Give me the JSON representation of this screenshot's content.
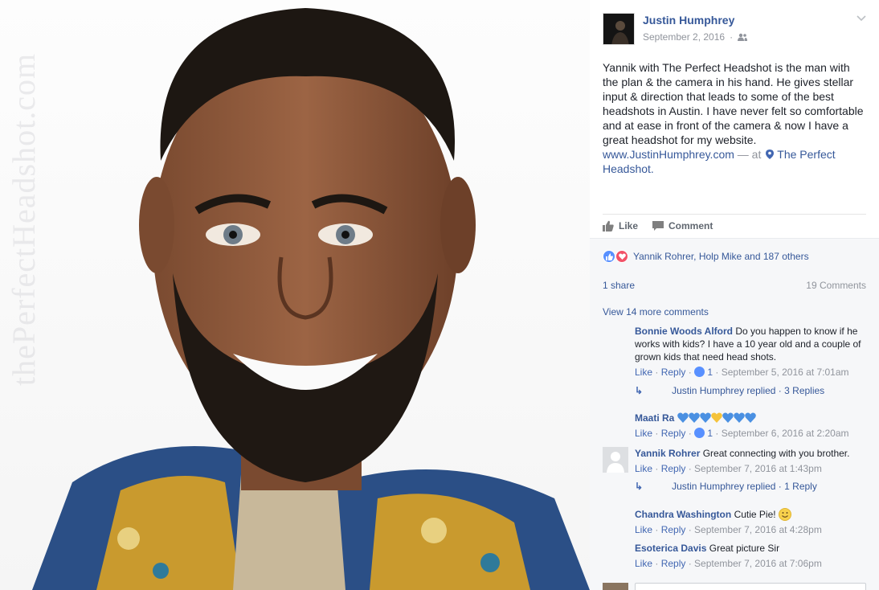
{
  "photo": {
    "watermark": "thePerfectHeadshot.com",
    "background_color": "#f8f8f8"
  },
  "post": {
    "author": "Justin Humphrey",
    "date": "September 2, 2016",
    "audience_icon": "friends-icon",
    "text": "Yannik with The Perfect Headshot is the man with the plan & the camera in his hand. He gives stellar input & direction that leads to some of the best headshots in Austin. I have never felt so comfortable and at ease in front of the camera & now I have a great headshot for my website.",
    "website": "www.JustinHumphrey.com",
    "at_separator": " — at ",
    "location": "The Perfect Headshot.",
    "like_label": "Like",
    "comment_label": "Comment"
  },
  "engagement": {
    "reactions_text": "Yannik Rohrer, Holp Mike and 187 others",
    "shares": "1 share",
    "comments_count": "19 Comments",
    "view_more": "View 14 more comments"
  },
  "comments": [
    {
      "name": "Bonnie Woods Alford",
      "text": "Do you happen to know if he works with kids? I have a 10 year old and a couple of grown kids that need head shots.",
      "like": "Like",
      "reply": "Reply",
      "likes": "1",
      "time": "September 5, 2016 at 7:01am",
      "replies": {
        "who": "Justin Humphrey replied",
        "count": "3 Replies"
      }
    },
    {
      "name": "Maati Ra",
      "text": "",
      "like": "Like",
      "reply": "Reply",
      "likes": "1",
      "time": "September 6, 2016 at 2:20am"
    },
    {
      "name": "Yannik Rohrer",
      "text": "Great connecting with you brother.",
      "like": "Like",
      "reply": "Reply",
      "time": "September 7, 2016 at 1:43pm",
      "replies": {
        "who": "Justin Humphrey replied",
        "count": "1 Reply"
      }
    },
    {
      "name": "Chandra Washington",
      "text": "Cutie Pie!",
      "like": "Like",
      "reply": "Reply",
      "time": "September 7, 2016 at 4:28pm"
    },
    {
      "name": "Esoterica Davis",
      "text": "Great picture Sir",
      "like": "Like",
      "reply": "Reply",
      "time": "September 7, 2016 at 7:06pm"
    }
  ],
  "colors": {
    "link": "#365899",
    "muted": "#90949c",
    "like_blue": "#5890ff",
    "love_red": "#f25268",
    "heart_blue": "#4a90e2",
    "heart_yellow": "#f5c33b"
  },
  "separators": {
    "dot": " · "
  }
}
